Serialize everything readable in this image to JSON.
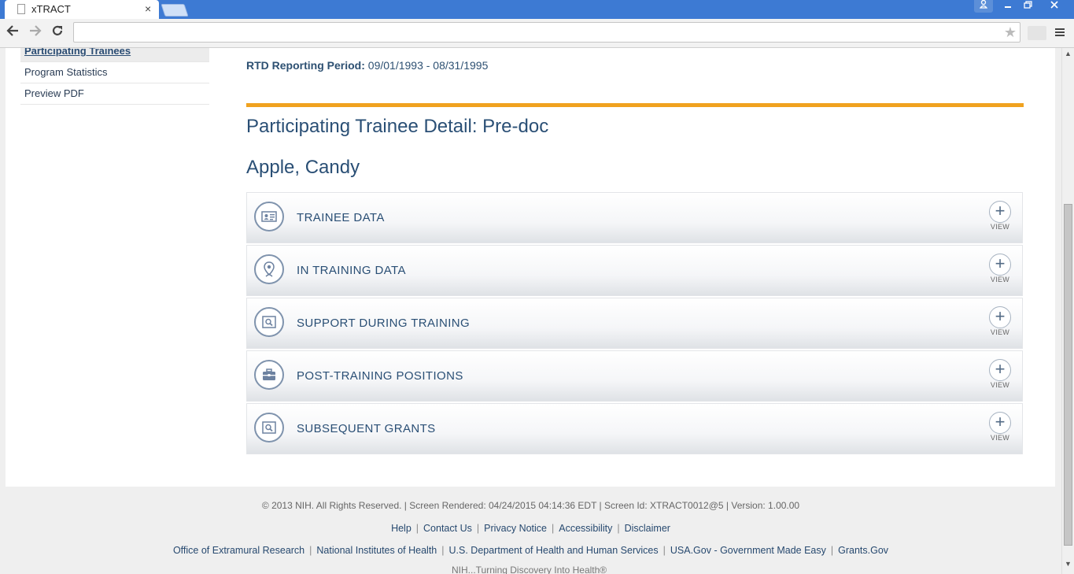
{
  "browser": {
    "tab_title": "xTRACT",
    "tab_close": "×",
    "icons": [
      "doc-icon",
      "back-arrow-icon",
      "forward-arrow-icon",
      "reload-icon",
      "star-icon",
      "menu-icon",
      "user-icon",
      "minimize-icon",
      "maximize-icon",
      "close-icon"
    ]
  },
  "sidebar": {
    "items": [
      {
        "label": "Participating Trainees",
        "active": true
      },
      {
        "label": "Program Statistics"
      },
      {
        "label": "Preview PDF"
      }
    ]
  },
  "main": {
    "rtd_label": "RTD Reporting Period:",
    "rtd_value": "09/01/1993 - 08/31/1995",
    "title": "Participating Trainee Detail: Pre-doc",
    "person_name": "Apple, Candy",
    "sections": [
      {
        "label": "TRAINEE DATA",
        "icon": "id-card-icon"
      },
      {
        "label": "IN TRAINING DATA",
        "icon": "map-pin-icon"
      },
      {
        "label": "SUPPORT DURING TRAINING",
        "icon": "search-document-icon"
      },
      {
        "label": "POST-TRAINING POSITIONS",
        "icon": "briefcase-icon"
      },
      {
        "label": "SUBSEQUENT GRANTS",
        "icon": "search-document-icon"
      }
    ],
    "view_label": "VIEW",
    "view_symbol": "+"
  },
  "footer": {
    "copyright": "© 2013 NIH. All Rights Reserved. | Screen Rendered: 04/24/2015 04:14:36 EDT | Screen Id: XTRACT0012@5 | Version: 1.00.00",
    "links1": [
      "Help",
      "Contact Us",
      "Privacy Notice",
      "Accessibility",
      "Disclaimer"
    ],
    "links2": [
      "Office of Extramural Research",
      "National Institutes of Health",
      "U.S. Department of Health and Human Services",
      "USA.Gov - Government Made Easy",
      "Grants.Gov"
    ],
    "tagline": "NIH...Turning Discovery Into Health®"
  },
  "colors": {
    "accent_orange": "#f0a21f",
    "heading_blue": "#2a4f75",
    "chrome_blue": "#3d7ad3"
  }
}
